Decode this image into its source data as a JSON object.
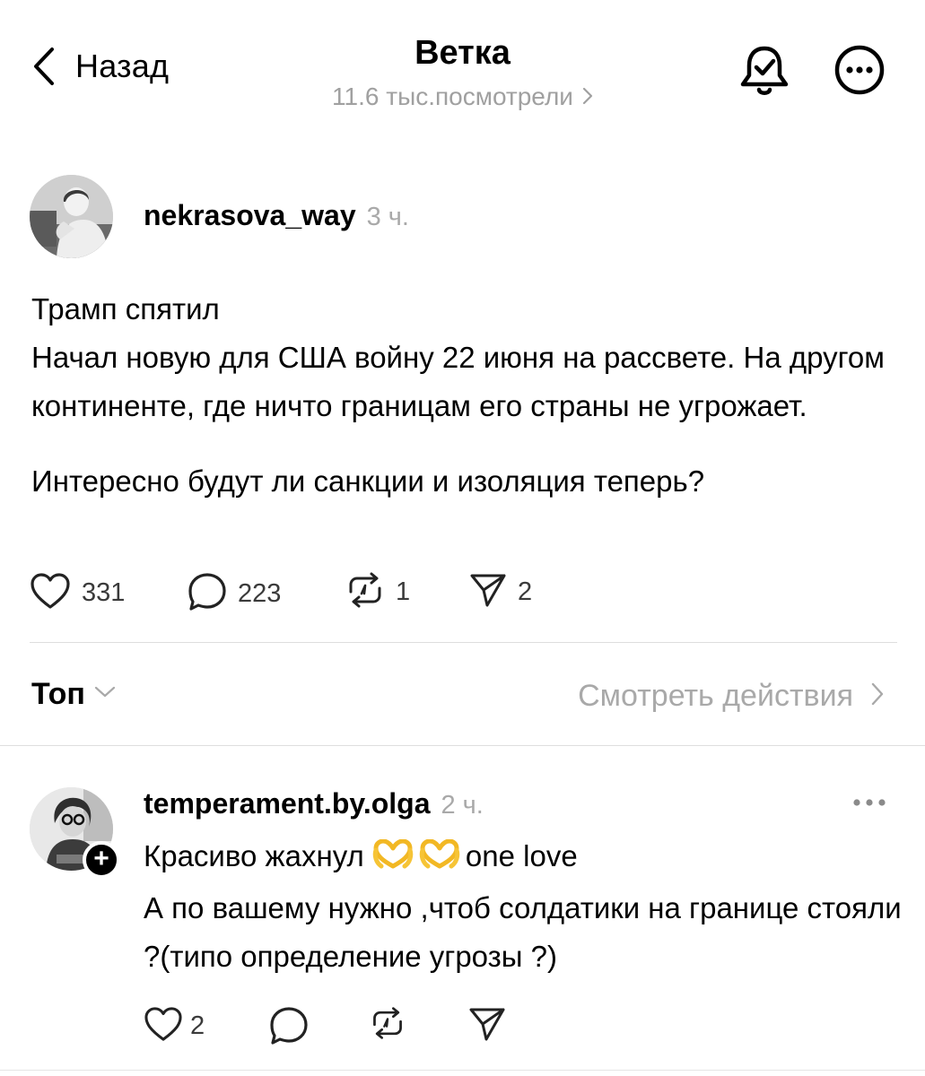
{
  "header": {
    "back_label": "Назад",
    "title": "Ветка",
    "views_text": "11.6 тыс.посмотрели"
  },
  "post": {
    "username": "nekrasova_way",
    "time": "3 ч.",
    "paragraphs": [
      "Трамп спятил",
      "Начал новую для США войну 22 июня на рассвете. На другом континенте, где ничто границам его страны не угрожает.",
      "Интересно будут ли санкции и изоляция теперь?"
    ],
    "likes": "331",
    "comments": "223",
    "reposts": "1",
    "shares": "2"
  },
  "sort": {
    "label": "Топ",
    "activity_link": "Смотреть действия"
  },
  "reply": {
    "username": "temperament.by.olga",
    "time": "2 ч.",
    "line1_text": "Красиво жахнул",
    "line1_suffix": "one love",
    "line1_emojis": [
      "heart-hands-emoji",
      "heart-hands-emoji"
    ],
    "body": "А по вашему нужно ,чтоб солдатики на границе стояли ?(типо определение угрозы ?)",
    "likes": "2"
  },
  "colors": {
    "text": "#000000",
    "muted": "#a9a9a9",
    "divider": "#dedede",
    "emoji": "#f6c436"
  },
  "icons": [
    "back-chevron-icon",
    "chevron-right-icon",
    "bell-check-icon",
    "more-circle-icon",
    "heart-icon",
    "comment-icon",
    "repost-icon",
    "send-icon",
    "chevron-down-icon",
    "more-dots-icon",
    "plus-icon"
  ]
}
